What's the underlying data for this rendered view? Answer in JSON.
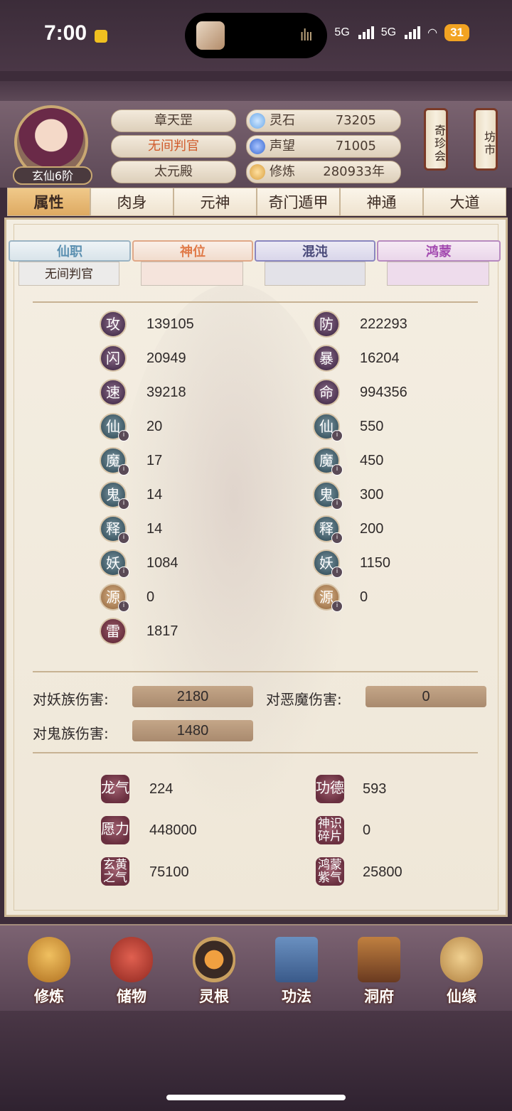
{
  "status_bar": {
    "time": "7:00",
    "signal1": "5G",
    "signal2": "5G",
    "battery": "31"
  },
  "player": {
    "rank": "玄仙6阶",
    "name": "章天罡",
    "title": "无间判官",
    "palace": "太元殿"
  },
  "resources": [
    {
      "label": "灵石",
      "value": "73205",
      "icon": "spirit-stone-icon",
      "color": "#6aa8e8"
    },
    {
      "label": "声望",
      "value": "71005",
      "icon": "crystal-icon",
      "color": "#3a6ad0"
    },
    {
      "label": "修炼",
      "value": "280933年",
      "icon": "meditation-icon",
      "color": "#d9a040"
    }
  ],
  "side_buttons": {
    "treasure": "奇珍会",
    "market": "坊市"
  },
  "tabs": [
    "属性",
    "肉身",
    "元神",
    "奇门遁甲",
    "神通",
    "大道"
  ],
  "ranks": {
    "banners": [
      "仙职",
      "神位",
      "混沌",
      "鸿蒙"
    ],
    "slots": [
      "无间判官",
      "",
      "",
      ""
    ]
  },
  "stats_left": [
    {
      "icon": "攻",
      "value": "139105"
    },
    {
      "icon": "闪",
      "value": "20949"
    },
    {
      "icon": "速",
      "value": "39218"
    },
    {
      "icon": "仙",
      "value": "20"
    },
    {
      "icon": "魔",
      "value": "17"
    },
    {
      "icon": "鬼",
      "value": "14"
    },
    {
      "icon": "释",
      "value": "14"
    },
    {
      "icon": "妖",
      "value": "1084"
    },
    {
      "icon": "源",
      "value": "0"
    },
    {
      "icon": "雷",
      "value": "1817"
    }
  ],
  "stats_right": [
    {
      "icon": "防",
      "value": "222293"
    },
    {
      "icon": "暴",
      "value": "16204"
    },
    {
      "icon": "命",
      "value": "994356"
    },
    {
      "icon": "仙",
      "value": "550"
    },
    {
      "icon": "魔",
      "value": "450"
    },
    {
      "icon": "鬼",
      "value": "300"
    },
    {
      "icon": "释",
      "value": "200"
    },
    {
      "icon": "妖",
      "value": "1150"
    },
    {
      "icon": "源",
      "value": "0"
    }
  ],
  "damage": [
    {
      "label": "对妖族伤害:",
      "value": "2180"
    },
    {
      "label": "对恶魔伤害:",
      "value": "0"
    },
    {
      "label": "对鬼族伤害:",
      "value": "1480"
    }
  ],
  "extras": [
    {
      "icon": "龙气",
      "value": "224"
    },
    {
      "icon": "功德",
      "value": "593"
    },
    {
      "icon": "愿力",
      "value": "448000"
    },
    {
      "icon": "神识碎片",
      "value": "0"
    },
    {
      "icon": "玄黄之气",
      "value": "75100"
    },
    {
      "icon": "鸿蒙紫气",
      "value": "25800"
    }
  ],
  "bottom_nav": [
    "修炼",
    "储物",
    "灵根",
    "功法",
    "洞府",
    "仙缘"
  ]
}
